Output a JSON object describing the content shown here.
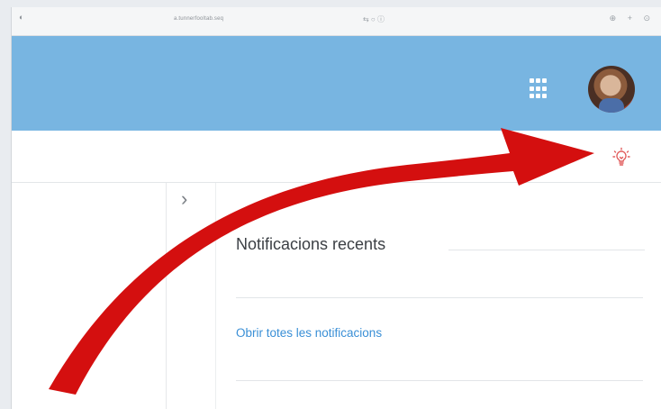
{
  "browser": {
    "back_glyph": "◐",
    "url": "a.tunnerfooltab.seq",
    "center_icons": "⇆ ○  ⓘ",
    "right_icons": "⊕ + ⊙"
  },
  "header": {
    "apps_icon": "apps-grid-icon",
    "avatar_icon": "user-avatar"
  },
  "toolbar": {
    "bulb_icon": "lightbulb-icon",
    "bulb_color": "#e15a5a"
  },
  "sidebar": {
    "toggle_glyph": "›"
  },
  "notifications": {
    "title": "Notificacions recents",
    "open_all_link": "Obrir totes les notificacions"
  },
  "colors": {
    "topbar": "#78b5e1",
    "link": "#3a8fd6",
    "arrow": "#d40f0f"
  }
}
